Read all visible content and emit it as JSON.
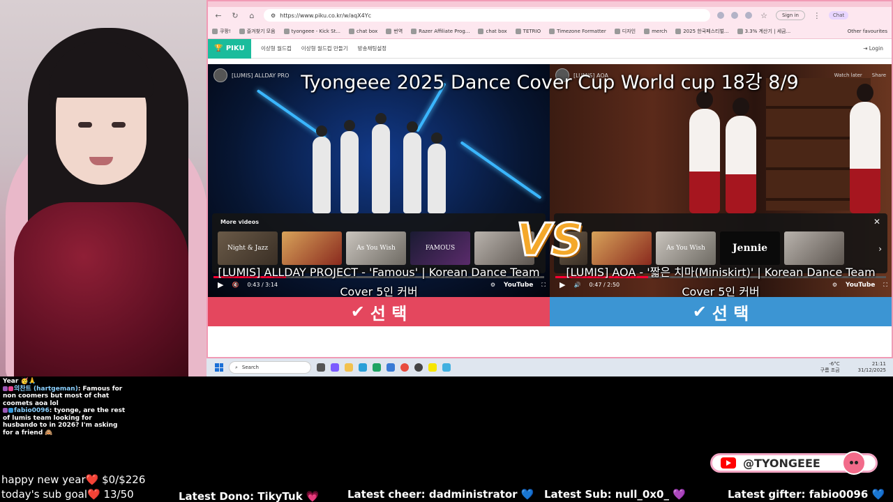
{
  "browser": {
    "url": "https://www.piku.co.kr/w/aqX4Yc",
    "signin_label": "Sign in",
    "chat_label": "Chat",
    "bookmarks": [
      "쿠팡!",
      "즐겨찾기 모음",
      "tyongeee - Kick St...",
      "chat box",
      "번역",
      "Razer Affiliate Prog...",
      "chat box",
      "TETRIO",
      "Timezone Formatter",
      "디자인",
      "merch",
      "2025 한국페스티벌...",
      "3.3% 계산기 | 세금..."
    ],
    "other_favourites": "Other favourites"
  },
  "site": {
    "logo": "PIKU",
    "nav": [
      "이상형 월드컵",
      "이상형 월드컵 만들기",
      "방송채팅설정"
    ],
    "login": "Login"
  },
  "worldcup": {
    "title": "Tyongeee 2025 Dance Cover Cup World cup   18강   8/9",
    "vs": "VS",
    "left": {
      "yt_title": "[LUMIS] ALLDAY PRO",
      "song": "[LUMIS] ALLDAY PROJECT - 'Famous' | Korean Dance Team Cover 5인 커버",
      "time": "0:43 / 3:14",
      "select": "선 택"
    },
    "right": {
      "yt_title": "[LUMIS] AOA",
      "song": "[LUMIS] AOA - '짧은 치마(Miniskirt)' | Korean Dance Team Cover 5인 커버",
      "time": "0:47 / 2:50",
      "select": "선 택"
    },
    "more_videos": "More videos",
    "watch_later": "Watch later",
    "share": "Share",
    "youtube": "YouTube",
    "thumbs": [
      "Night & Jazz",
      "",
      "As You Wish",
      "FAMOUS",
      "",
      "Jennie"
    ]
  },
  "taskbar": {
    "search": "Search",
    "weather": "-6°C",
    "weather_desc": "구름 조금",
    "time": "21:11",
    "date": "31/12/2025"
  },
  "chat": [
    {
      "user": "",
      "text": "Year 🥳🙏"
    },
    {
      "user": "의찬트 (hartgeman)",
      "text": ": Famous for non coomers but most of chat coomets aoa lol"
    },
    {
      "user": "fabio0096",
      "text": ": tyonge, are the rest of lumis team looking for husbando to in 2026? I'm asking for a friend 🙈"
    }
  ],
  "overlay": {
    "goal1": "happy new year❤️  $0/$226",
    "goal2": "today's sub goal❤️  13/50",
    "latest_dono": "Latest Dono: TikyTuk 💗",
    "latest_cheer": "Latest cheer: dadministrator 💙",
    "latest_sub": "Latest Sub: null_0x0_ 💜",
    "latest_gifter": "Latest gifter: fabio0096 💙",
    "handle": "@TYONGEEE"
  }
}
